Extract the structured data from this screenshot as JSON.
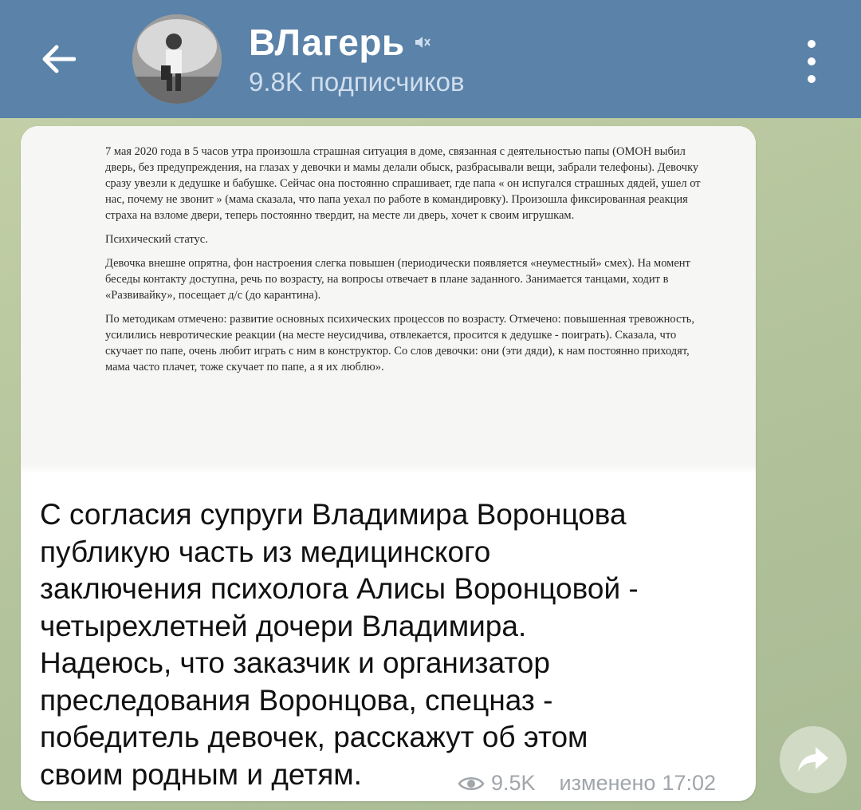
{
  "header": {
    "title": "ВЛагерь",
    "subscribers": "9.8K подписчиков",
    "icons": {
      "back": "back-arrow-icon",
      "muted": "muted-speaker-icon",
      "menu": "more-vertical-icon"
    },
    "colors": {
      "background": "#5b82a8",
      "title": "#ffffff",
      "subtitle": "#cfdeee"
    }
  },
  "message": {
    "document": {
      "paragraphs": [
        "7 мая 2020 года в 5 часов утра произошла страшная ситуация в доме, связанная с деятельностью папы (ОМОН выбил дверь, без предупреждения, на глазах у девочки и мамы делали обыск, разбрасывали вещи, забрали телефоны). Девочку сразу увезли к дедушке и бабушке. Сейчас она постоянно спрашивает, где папа « он испугался страшных дядей, ушел от нас, почему не звонит » (мама сказала, что папа уехал по работе в командировку). Произошла фиксированная реакция страха на взломе двери, теперь постоянно твердит, на месте ли дверь, хочет к своим игрушкам.",
        "Психический статус.",
        "Девочка внешне опрятна, фон настроения слегка повышен (периодически появляется «неуместный» смех). На момент беседы контакту доступна, речь по возрасту, на вопросы отвечает в плане заданного. Занимается танцами, ходит в «Развивайку», посещает д/с (до карантина).",
        "По методикам отмечено: развитие основных психических процессов по возрасту. Отмечено: повышенная тревожность, усилились невротические реакции (на месте неусидчива, отвлекается, просится к дедушке - поиграть). Сказала, что скучает по папе, очень любит играть с ним в конструктор. Со слов девочки: они (эти дяди), к нам постоянно приходят, мама часто плачет, тоже скучает по папе, а я их люблю»."
      ]
    },
    "caption": "С согласия супруги Владимира Воронцова\nпубликую часть из медицинского\nзаключения психолога Алисы Воронцовой -\nчетырехлетней дочери Владимира.\nНадеюсь, что заказчик и организатор\nпреследования Воронцова, спецназ -\nпобедитель девочек, расскажут об этом\nсвоим родным и детям.",
    "views": "9.5K",
    "edited_label": "изменено",
    "time": "17:02",
    "icons": {
      "views": "eye-icon",
      "share": "share-arrow-icon"
    }
  }
}
